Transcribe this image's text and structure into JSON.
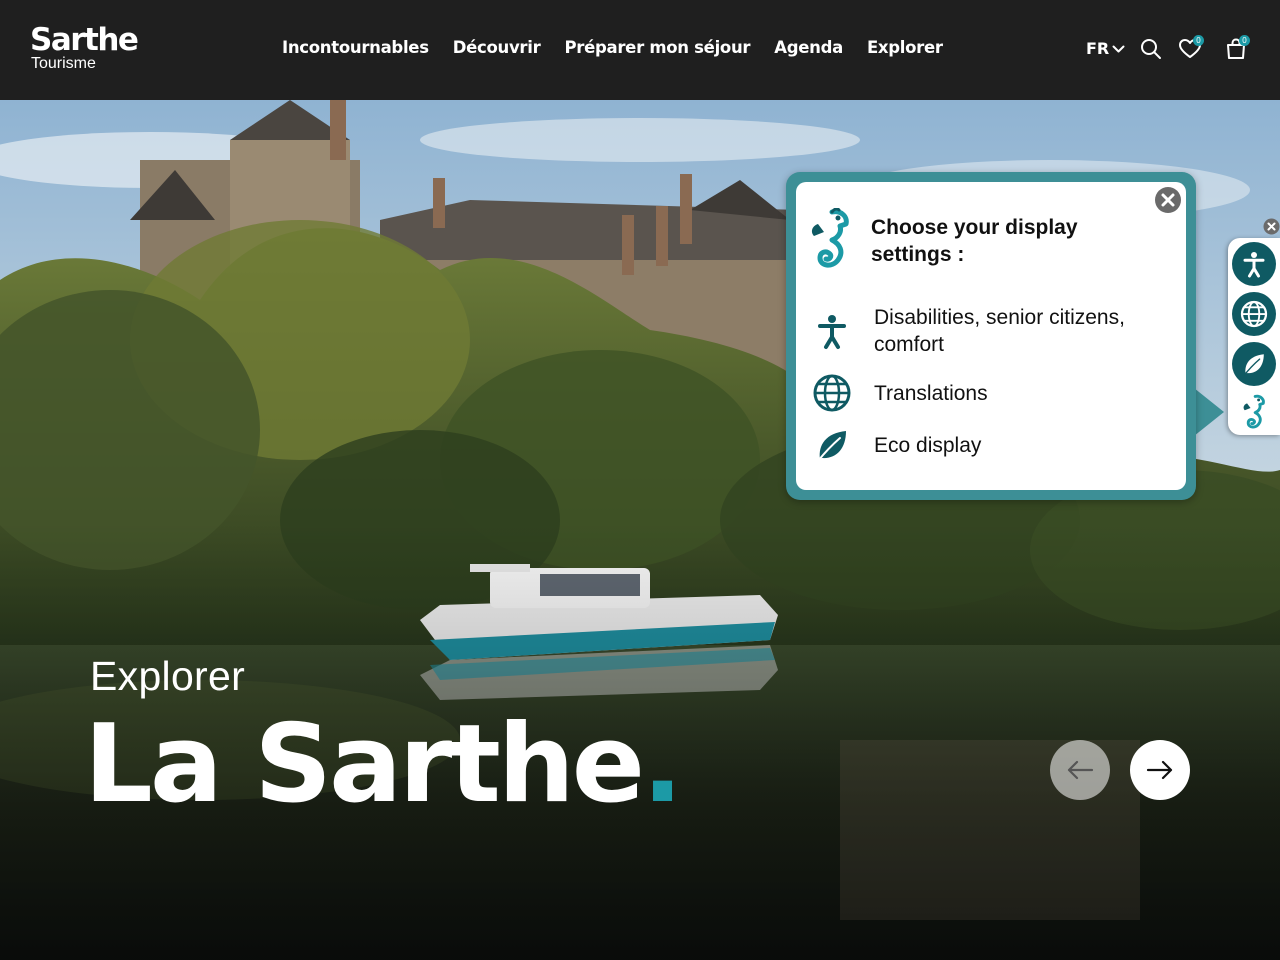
{
  "brand": {
    "name": "Sarthe",
    "subname": "Tourisme"
  },
  "nav": {
    "items": [
      {
        "label": "Incontournables"
      },
      {
        "label": "Découvrir"
      },
      {
        "label": "Préparer mon séjour"
      },
      {
        "label": "Agenda"
      },
      {
        "label": "Explorer"
      }
    ]
  },
  "header": {
    "language": "FR",
    "favorites_count": "0",
    "cart_count": "0",
    "icons": [
      "chevron-down-icon",
      "search-icon",
      "heart-icon",
      "shopping-bag-icon"
    ]
  },
  "hero": {
    "subtitle": "Explorer",
    "title": "La Sarthe",
    "title_dot": "."
  },
  "popup": {
    "title": "Choose your display settings :",
    "options": [
      {
        "label": "Disabilities, senior citizens, comfort",
        "icon": "accessibility-icon"
      },
      {
        "label": "Translations",
        "icon": "globe-icon"
      },
      {
        "label": "Eco display",
        "icon": "leaf-icon"
      }
    ]
  },
  "toolbar": {
    "buttons": [
      "accessibility-icon",
      "globe-icon",
      "leaf-icon",
      "seahorse-icon"
    ]
  },
  "colors": {
    "header_bg": "#1f1f1f",
    "accent": "#1c9aa6",
    "popup_border": "#3d8f96",
    "toolbar_button": "#0f5a63"
  }
}
